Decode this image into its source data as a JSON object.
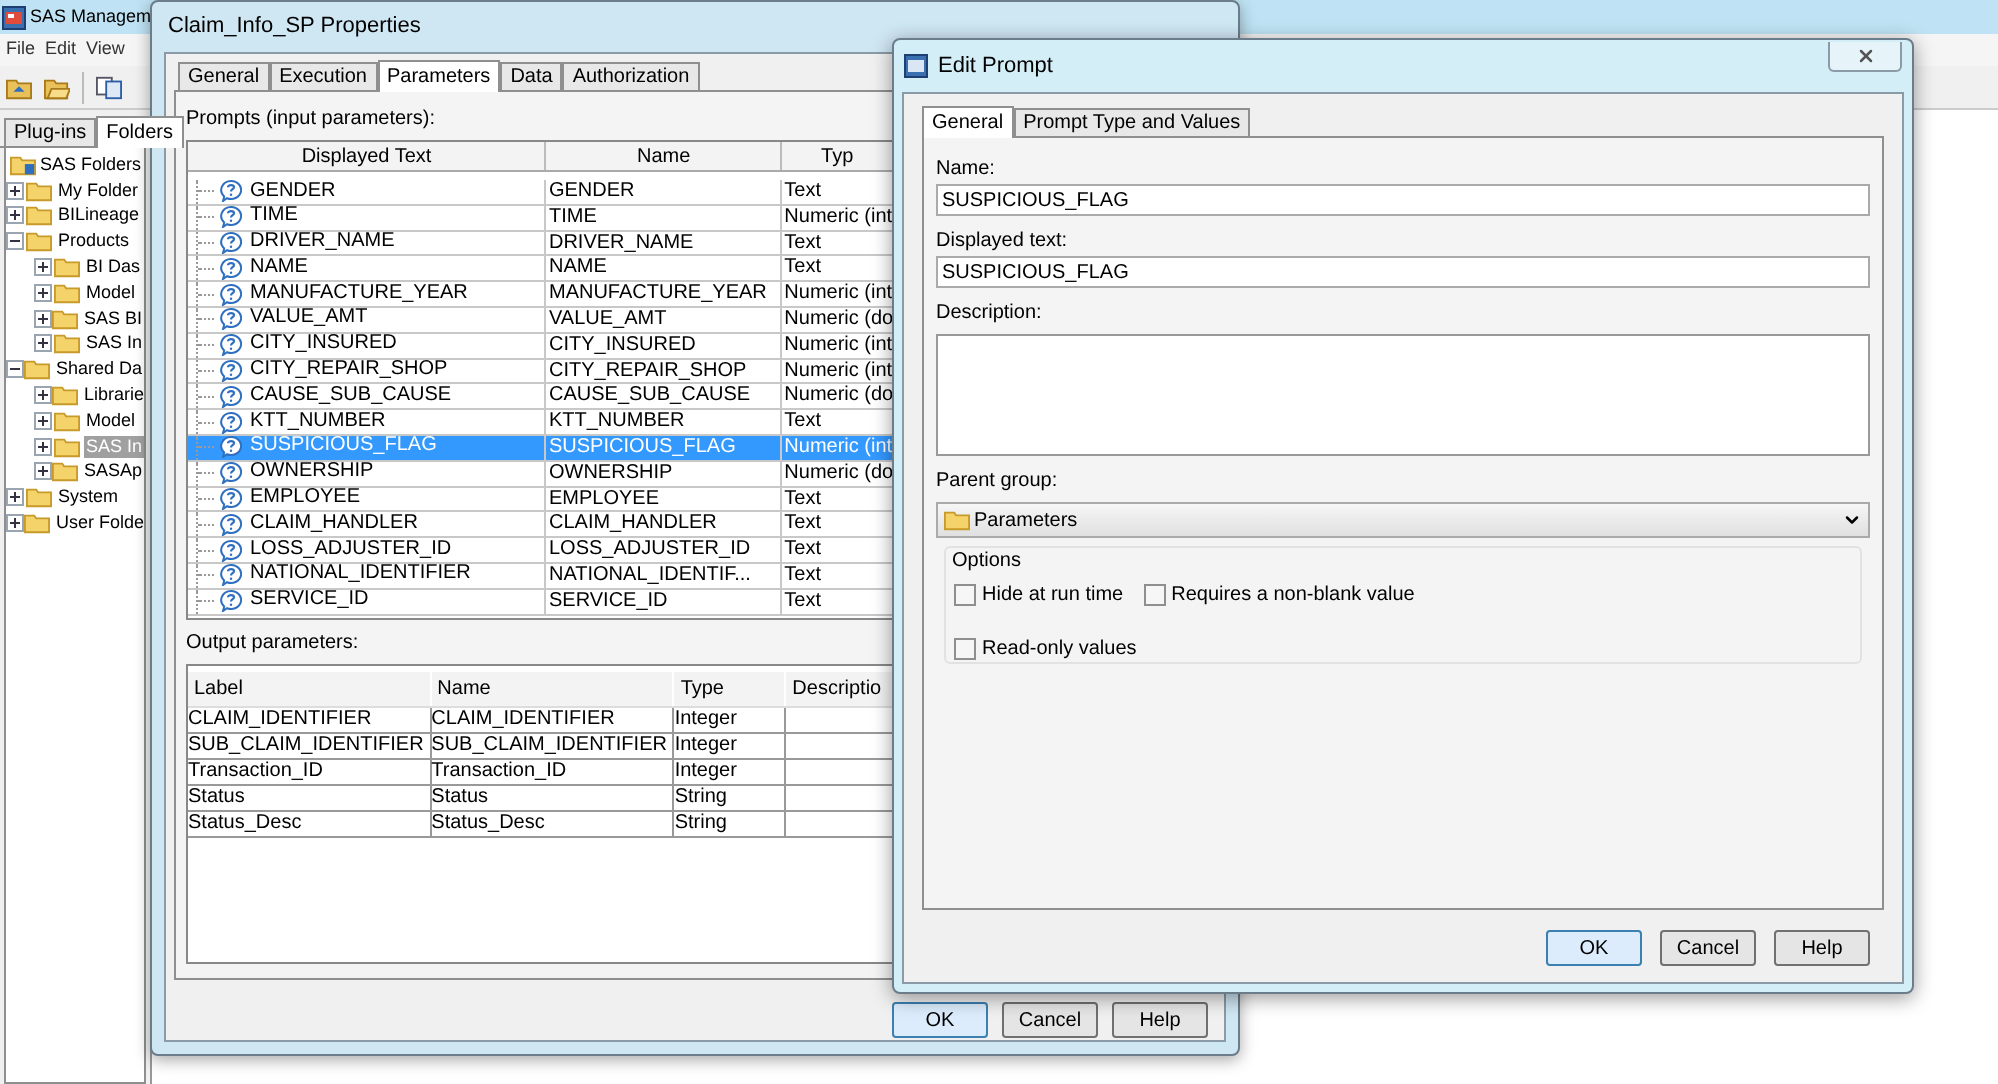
{
  "main_window": {
    "title": "SAS Managem",
    "menu": [
      "File",
      "Edit",
      "View"
    ],
    "tabs": [
      {
        "label": "Plug-ins",
        "selected": false
      },
      {
        "label": "Folders",
        "selected": true
      }
    ],
    "tree": [
      {
        "label": "SAS Folders",
        "selected": false,
        "children": [
          {
            "label": "My Folder",
            "expanded": false,
            "selected": false
          },
          {
            "label": "BILineage",
            "expanded": false,
            "selected": false
          },
          {
            "label": "Products",
            "expanded": true,
            "selected": false,
            "children": [
              {
                "label": "BI Das",
                "expanded": false,
                "selected": false
              },
              {
                "label": "Model",
                "expanded": false,
                "selected": false
              },
              {
                "label": "SAS BI",
                "expanded": false,
                "selected": false
              },
              {
                "label": "SAS In",
                "expanded": false,
                "selected": false
              }
            ]
          },
          {
            "label": "Shared Da",
            "expanded": true,
            "selected": false,
            "children": [
              {
                "label": "Librarie",
                "expanded": false,
                "selected": false
              },
              {
                "label": "Model",
                "expanded": false,
                "selected": false
              },
              {
                "label": "SAS In",
                "expanded": false,
                "selected": true
              },
              {
                "label": "SASAp",
                "expanded": false,
                "selected": false
              }
            ]
          },
          {
            "label": "System",
            "expanded": false,
            "selected": false
          },
          {
            "label": "User Folde",
            "expanded": false,
            "selected": false
          }
        ]
      }
    ]
  },
  "properties_dialog": {
    "title": "Claim_Info_SP Properties",
    "tabs": [
      {
        "label": "General",
        "selected": false
      },
      {
        "label": "Execution",
        "selected": false
      },
      {
        "label": "Parameters",
        "selected": true
      },
      {
        "label": "Data",
        "selected": false
      },
      {
        "label": "Authorization",
        "selected": false
      }
    ],
    "prompts_label": "Prompts (input parameters):",
    "prompts_columns": [
      "Displayed Text",
      "Name",
      "Typ"
    ],
    "prompts": [
      {
        "displayed_text": "GENDER",
        "name": "GENDER",
        "type": "Text",
        "selected": false
      },
      {
        "displayed_text": "TIME",
        "name": "TIME",
        "type": "Numeric (int",
        "selected": false
      },
      {
        "displayed_text": "DRIVER_NAME",
        "name": "DRIVER_NAME",
        "type": "Text",
        "selected": false
      },
      {
        "displayed_text": "NAME",
        "name": "NAME",
        "type": "Text",
        "selected": false
      },
      {
        "displayed_text": "MANUFACTURE_YEAR",
        "name": "MANUFACTURE_YEAR",
        "type": "Numeric (int",
        "selected": false
      },
      {
        "displayed_text": "VALUE_AMT",
        "name": "VALUE_AMT",
        "type": "Numeric (do",
        "selected": false
      },
      {
        "displayed_text": "CITY_INSURED",
        "name": "CITY_INSURED",
        "type": "Numeric (int",
        "selected": false
      },
      {
        "displayed_text": "CITY_REPAIR_SHOP",
        "name": "CITY_REPAIR_SHOP",
        "type": "Numeric (int",
        "selected": false
      },
      {
        "displayed_text": "CAUSE_SUB_CAUSE",
        "name": "CAUSE_SUB_CAUSE",
        "type": "Numeric (do",
        "selected": false
      },
      {
        "displayed_text": "KTT_NUMBER",
        "name": "KTT_NUMBER",
        "type": "Text",
        "selected": false
      },
      {
        "displayed_text": "SUSPICIOUS_FLAG",
        "name": "SUSPICIOUS_FLAG",
        "type": "Numeric (int",
        "selected": true
      },
      {
        "displayed_text": "OWNERSHIP",
        "name": "OWNERSHIP",
        "type": "Numeric (do",
        "selected": false
      },
      {
        "displayed_text": "EMPLOYEE",
        "name": "EMPLOYEE",
        "type": "Text",
        "selected": false
      },
      {
        "displayed_text": "CLAIM_HANDLER",
        "name": "CLAIM_HANDLER",
        "type": "Text",
        "selected": false
      },
      {
        "displayed_text": "LOSS_ADJUSTER_ID",
        "name": "LOSS_ADJUSTER_ID",
        "type": "Text",
        "selected": false
      },
      {
        "displayed_text": "NATIONAL_IDENTIFIER",
        "name": "NATIONAL_IDENTIF...",
        "type": "Text",
        "selected": false
      },
      {
        "displayed_text": "SERVICE_ID",
        "name": "SERVICE_ID",
        "type": "Text",
        "selected": false
      }
    ],
    "output_label": "Output parameters:",
    "output_columns": [
      "Label",
      "Name",
      "Type",
      "Descriptio"
    ],
    "outputs": [
      {
        "label": "CLAIM_IDENTIFIER",
        "name": "CLAIM_IDENTIFIER",
        "type": "Integer"
      },
      {
        "label": "SUB_CLAIM_IDENTIFIER",
        "name": "SUB_CLAIM_IDENTIFIER",
        "type": "Integer"
      },
      {
        "label": "Transaction_ID",
        "name": "Transaction_ID",
        "type": "Integer"
      },
      {
        "label": "Status",
        "name": "Status",
        "type": "String"
      },
      {
        "label": "Status_Desc",
        "name": "Status_Desc",
        "type": "String"
      }
    ],
    "buttons": [
      {
        "label": "OK",
        "default": true
      },
      {
        "label": "Cancel",
        "default": false
      },
      {
        "label": "Help",
        "default": false
      }
    ]
  },
  "edit_prompt": {
    "title": "Edit Prompt",
    "tabs": [
      {
        "label": "General",
        "selected": true
      },
      {
        "label": "Prompt Type and Values",
        "selected": false
      }
    ],
    "name_label": "Name:",
    "name_value": "SUSPICIOUS_FLAG",
    "displayed_text_label": "Displayed text:",
    "displayed_text_value": "SUSPICIOUS_FLAG",
    "description_label": "Description:",
    "parent_group_label": "Parent group:",
    "parent_group_value": "Parameters",
    "options_label": "Options",
    "options": [
      {
        "label": "Hide at run time",
        "checked": false
      },
      {
        "label": "Requires a non-blank value",
        "checked": false
      },
      {
        "label": "Read-only values",
        "checked": false
      }
    ],
    "buttons": [
      {
        "label": "OK",
        "default": true
      },
      {
        "label": "Cancel",
        "default": false
      },
      {
        "label": "Help",
        "default": false
      }
    ]
  }
}
